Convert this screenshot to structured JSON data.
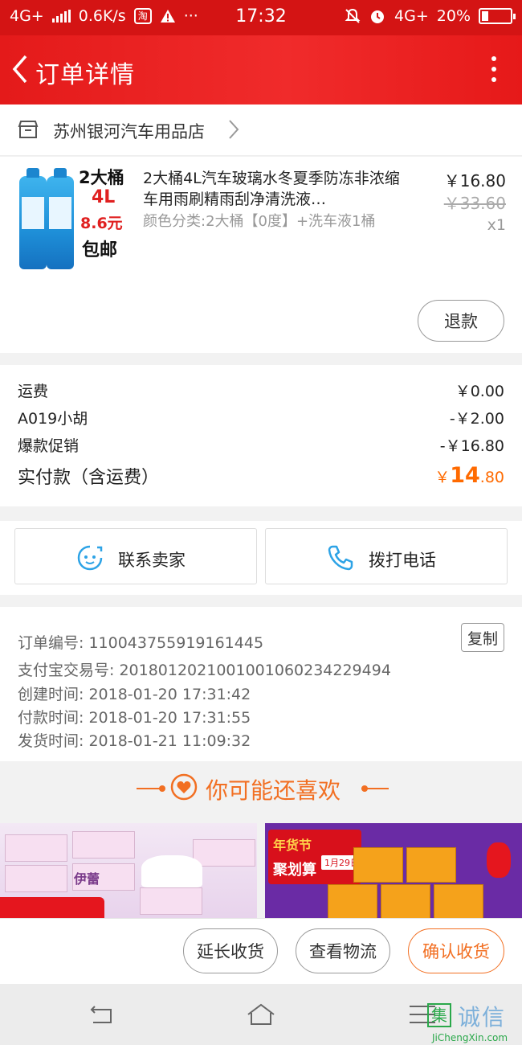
{
  "status_bar": {
    "network": "4G+",
    "speed": "0.6K/s",
    "app_badge": "淘",
    "more": "···",
    "time": "17:32",
    "network_right": "4G+",
    "battery": "20%"
  },
  "header": {
    "title": "订单详情"
  },
  "shop": {
    "name": "苏州银河汽车用品店"
  },
  "product": {
    "image_text": {
      "line1": "2大桶",
      "line2": "4L",
      "line3": "8.6元",
      "line4": "包邮"
    },
    "title": "2大桶4L汽车玻璃水冬夏季防冻非浓缩车用雨刷精雨刮净清洗液…",
    "spec": "颜色分类:2大桶【0度】+洗车液1桶",
    "price": "￥16.80",
    "original_price": "￥33.60",
    "quantity": "x1",
    "refund_label": "退款"
  },
  "totals": {
    "rows": [
      {
        "label": "运费",
        "value": "￥0.00"
      },
      {
        "label": "A019小胡",
        "value": "-￥2.00"
      },
      {
        "label": "爆款促销",
        "value": "-￥16.80"
      }
    ],
    "paid_label": "实付款（含运费）",
    "paid_currency": "￥",
    "paid_int": "14",
    "paid_dec": ".80"
  },
  "contact": {
    "seller_label": "联系卖家",
    "phone_label": "拨打电话"
  },
  "order_info": {
    "order_no": "订单编号: 110043755919161445",
    "copy_label": "复制",
    "alipay_no": "支付宝交易号: 2018012021001001060234229494",
    "created": "创建时间: 2018-01-20 17:31:42",
    "paid": "付款时间: 2018-01-20 17:31:55",
    "shipped": "发货时间: 2018-01-21 11:09:32"
  },
  "recommend": {
    "title": "你可能还喜欢",
    "card_a_brand": "伊蕾",
    "card_b_line1": "年货节",
    "card_b_line2": "聚划算",
    "card_b_tag": "1月29日"
  },
  "actions": {
    "extend_label": "延长收货",
    "logistics_label": "查看物流",
    "confirm_label": "确认收货"
  },
  "watermark": {
    "cn": "诚信",
    "glyph": "集",
    "en": "JiChengXin.com"
  },
  "colors": {
    "header_red": "#e41a1a",
    "accent_orange": "#f26f22",
    "price_orange": "#ff6a00"
  }
}
